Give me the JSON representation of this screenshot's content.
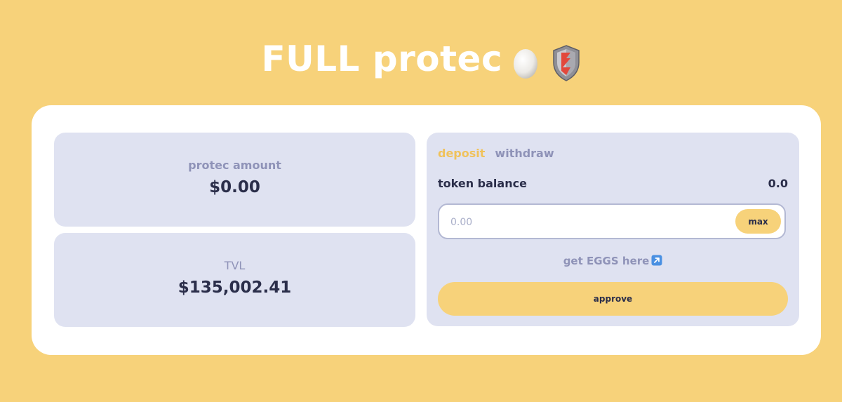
{
  "header": {
    "title": "FULL protec",
    "icons": [
      "egg-icon",
      "shield-icon"
    ]
  },
  "stats": {
    "protec_amount": {
      "label": "protec amount",
      "value": "$0.00"
    },
    "tvl": {
      "label": "TVL",
      "value": "$135,002.41"
    }
  },
  "panel": {
    "tabs": {
      "deposit": "deposit",
      "withdraw": "withdraw",
      "active": "deposit"
    },
    "balance": {
      "label": "token balance",
      "value": "0.0"
    },
    "amount": {
      "placeholder": "0.00",
      "value": ""
    },
    "max_label": "max",
    "eggs_link": "get EGGS here",
    "approve_label": "approve"
  },
  "colors": {
    "background": "#F7D27A",
    "card": "#FFFFFF",
    "panel": "#DFE2F1",
    "accent": "#F7D27A",
    "active_tab": "#F0C25B",
    "muted_text": "#8F93B8",
    "dark_text": "#2B2E4A"
  }
}
